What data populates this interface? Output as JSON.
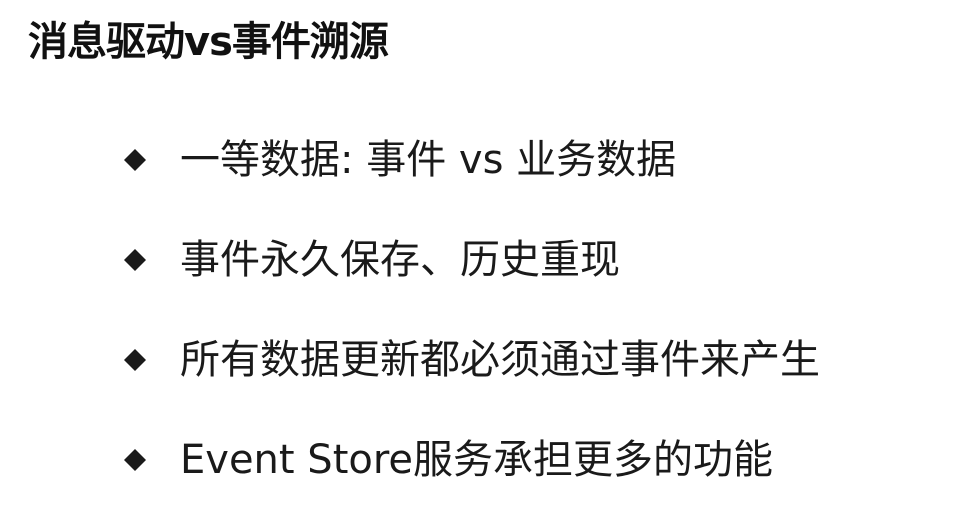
{
  "slide": {
    "title": "消息驱动vs事件溯源",
    "bullet_icon": "diamond-bullet-icon",
    "bullets": [
      "一等数据: 事件 vs 业务数据",
      "事件永久保存、历史重现",
      "所有数据更新都必须通过事件来产生",
      "Event Store服务承担更多的功能"
    ]
  },
  "colors": {
    "background": "#ffffff",
    "text": "#1a1a1a",
    "bullet": "#1a1a1a"
  }
}
